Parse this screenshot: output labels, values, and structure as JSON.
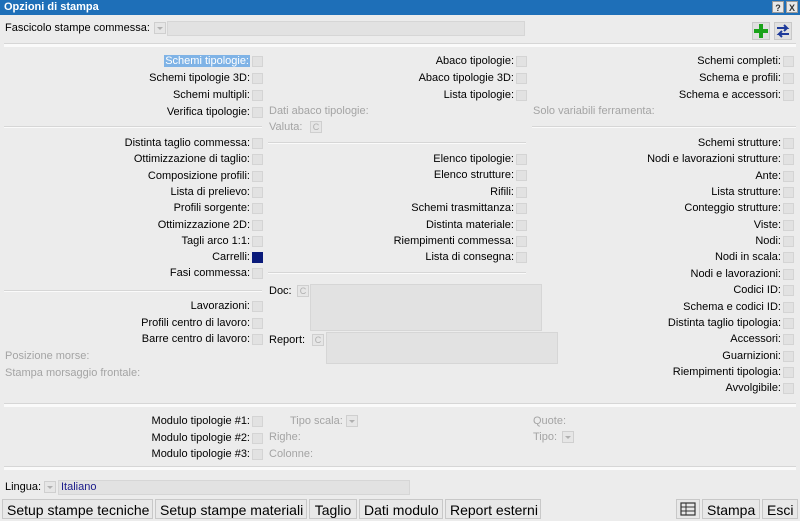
{
  "window": {
    "title": "Opzioni di stampa",
    "help_label": "?",
    "close_label": "X"
  },
  "top": {
    "fascicolo_label": "Fascicolo stampe commessa:"
  },
  "col1": [
    {
      "label": "Schemi tipologie:",
      "checked": false,
      "highlight": true
    },
    {
      "label": "Schemi tipologie 3D:",
      "checked": false
    },
    {
      "label": "Schemi multipli:",
      "checked": false
    },
    {
      "label": "Verifica tipologie:",
      "checked": false
    }
  ],
  "col2": [
    {
      "label": "Abaco tipologie:",
      "checked": false
    },
    {
      "label": "Abaco tipologie 3D:",
      "checked": false
    },
    {
      "label": "Lista tipologie:",
      "checked": false
    }
  ],
  "col3": [
    {
      "label": "Schemi completi:",
      "checked": false
    },
    {
      "label": "Schema e profili:",
      "checked": false
    },
    {
      "label": "Schema e accessori:",
      "checked": false
    }
  ],
  "dati_abaco_label": "Dati abaco tipologie:",
  "valuta_label": "Valuta:",
  "solo_variabili_label": "Solo variabili ferramenta:",
  "col1b": [
    {
      "label": "Distinta taglio commessa:",
      "checked": false
    },
    {
      "label": "Ottimizzazione di taglio:",
      "checked": false
    },
    {
      "label": "Composizione profili:",
      "checked": false
    },
    {
      "label": "Lista di prelievo:",
      "checked": false
    },
    {
      "label": "Profili sorgente:",
      "checked": false
    },
    {
      "label": "Ottimizzazione 2D:",
      "checked": false
    },
    {
      "label": "Tagli arco 1:1:",
      "checked": false
    },
    {
      "label": "Carrelli:",
      "checked": true
    },
    {
      "label": "Fasi commessa:",
      "checked": false
    }
  ],
  "col2b": [
    {
      "label": "Elenco tipologie:",
      "checked": false
    },
    {
      "label": "Elenco strutture:",
      "checked": false
    },
    {
      "label": "Rifili:",
      "checked": false
    },
    {
      "label": "Schemi trasmittanza:",
      "checked": false
    },
    {
      "label": "Distinta materiale:",
      "checked": false
    },
    {
      "label": "Riempimenti commessa:",
      "checked": false
    },
    {
      "label": "Lista di consegna:",
      "checked": false
    }
  ],
  "col3b": [
    {
      "label": "Schemi strutture:",
      "checked": false
    },
    {
      "label": "Nodi e lavorazioni strutture:",
      "checked": false
    },
    {
      "label": "Ante:",
      "checked": false
    },
    {
      "label": "Lista strutture:",
      "checked": false
    },
    {
      "label": "Conteggio strutture:",
      "checked": false
    },
    {
      "label": "Viste:",
      "checked": false
    },
    {
      "label": "Nodi:",
      "checked": false
    },
    {
      "label": "Nodi in scala:",
      "checked": false
    },
    {
      "label": "Nodi e lavorazioni:",
      "checked": false
    },
    {
      "label": "Codici ID:",
      "checked": false
    },
    {
      "label": "Schema e codici ID:",
      "checked": false
    },
    {
      "label": "Distinta taglio tipologia:",
      "checked": false
    },
    {
      "label": "Accessori:",
      "checked": false
    },
    {
      "label": "Guarnizioni:",
      "checked": false
    },
    {
      "label": "Riempimenti tipologia:",
      "checked": false
    },
    {
      "label": "Avvolgibile:",
      "checked": false
    }
  ],
  "col1c": [
    {
      "label": "Lavorazioni:",
      "checked": false
    },
    {
      "label": "Profili centro di lavoro:",
      "checked": false
    },
    {
      "label": "Barre centro di lavoro:",
      "checked": false
    }
  ],
  "posizione_morse_label": "Posizione morse:",
  "stampa_morsaggio_label": "Stampa morsaggio frontale:",
  "doc_label": "Doc:",
  "report_label": "Report:",
  "c_glyph": "C",
  "moduli": [
    {
      "label": "Modulo tipologie #1:",
      "checked": false
    },
    {
      "label": "Modulo tipologie #2:",
      "checked": false
    },
    {
      "label": "Modulo tipologie #3:",
      "checked": false
    }
  ],
  "tipo_scala_label": "Tipo scala:",
  "righe_label": "Righe:",
  "colonne_label": "Colonne:",
  "quote_label": "Quote:",
  "tipo_label": "Tipo:",
  "lingua": {
    "label": "Lingua:",
    "value": "Italiano"
  },
  "buttons": {
    "setup_tecniche": "Setup stampe tecniche",
    "setup_materiali": "Setup stampe materiali",
    "taglio": "Taglio",
    "dati_modulo": "Dati modulo",
    "report_esterni": "Report esterni",
    "stampa": "Stampa",
    "esci": "Esci"
  },
  "colors": {
    "titlebar": "#1e6fb8",
    "checked": "#0a1a7a",
    "add_icon": "#1aa31a",
    "swap_icon": "#1d3a9a"
  }
}
